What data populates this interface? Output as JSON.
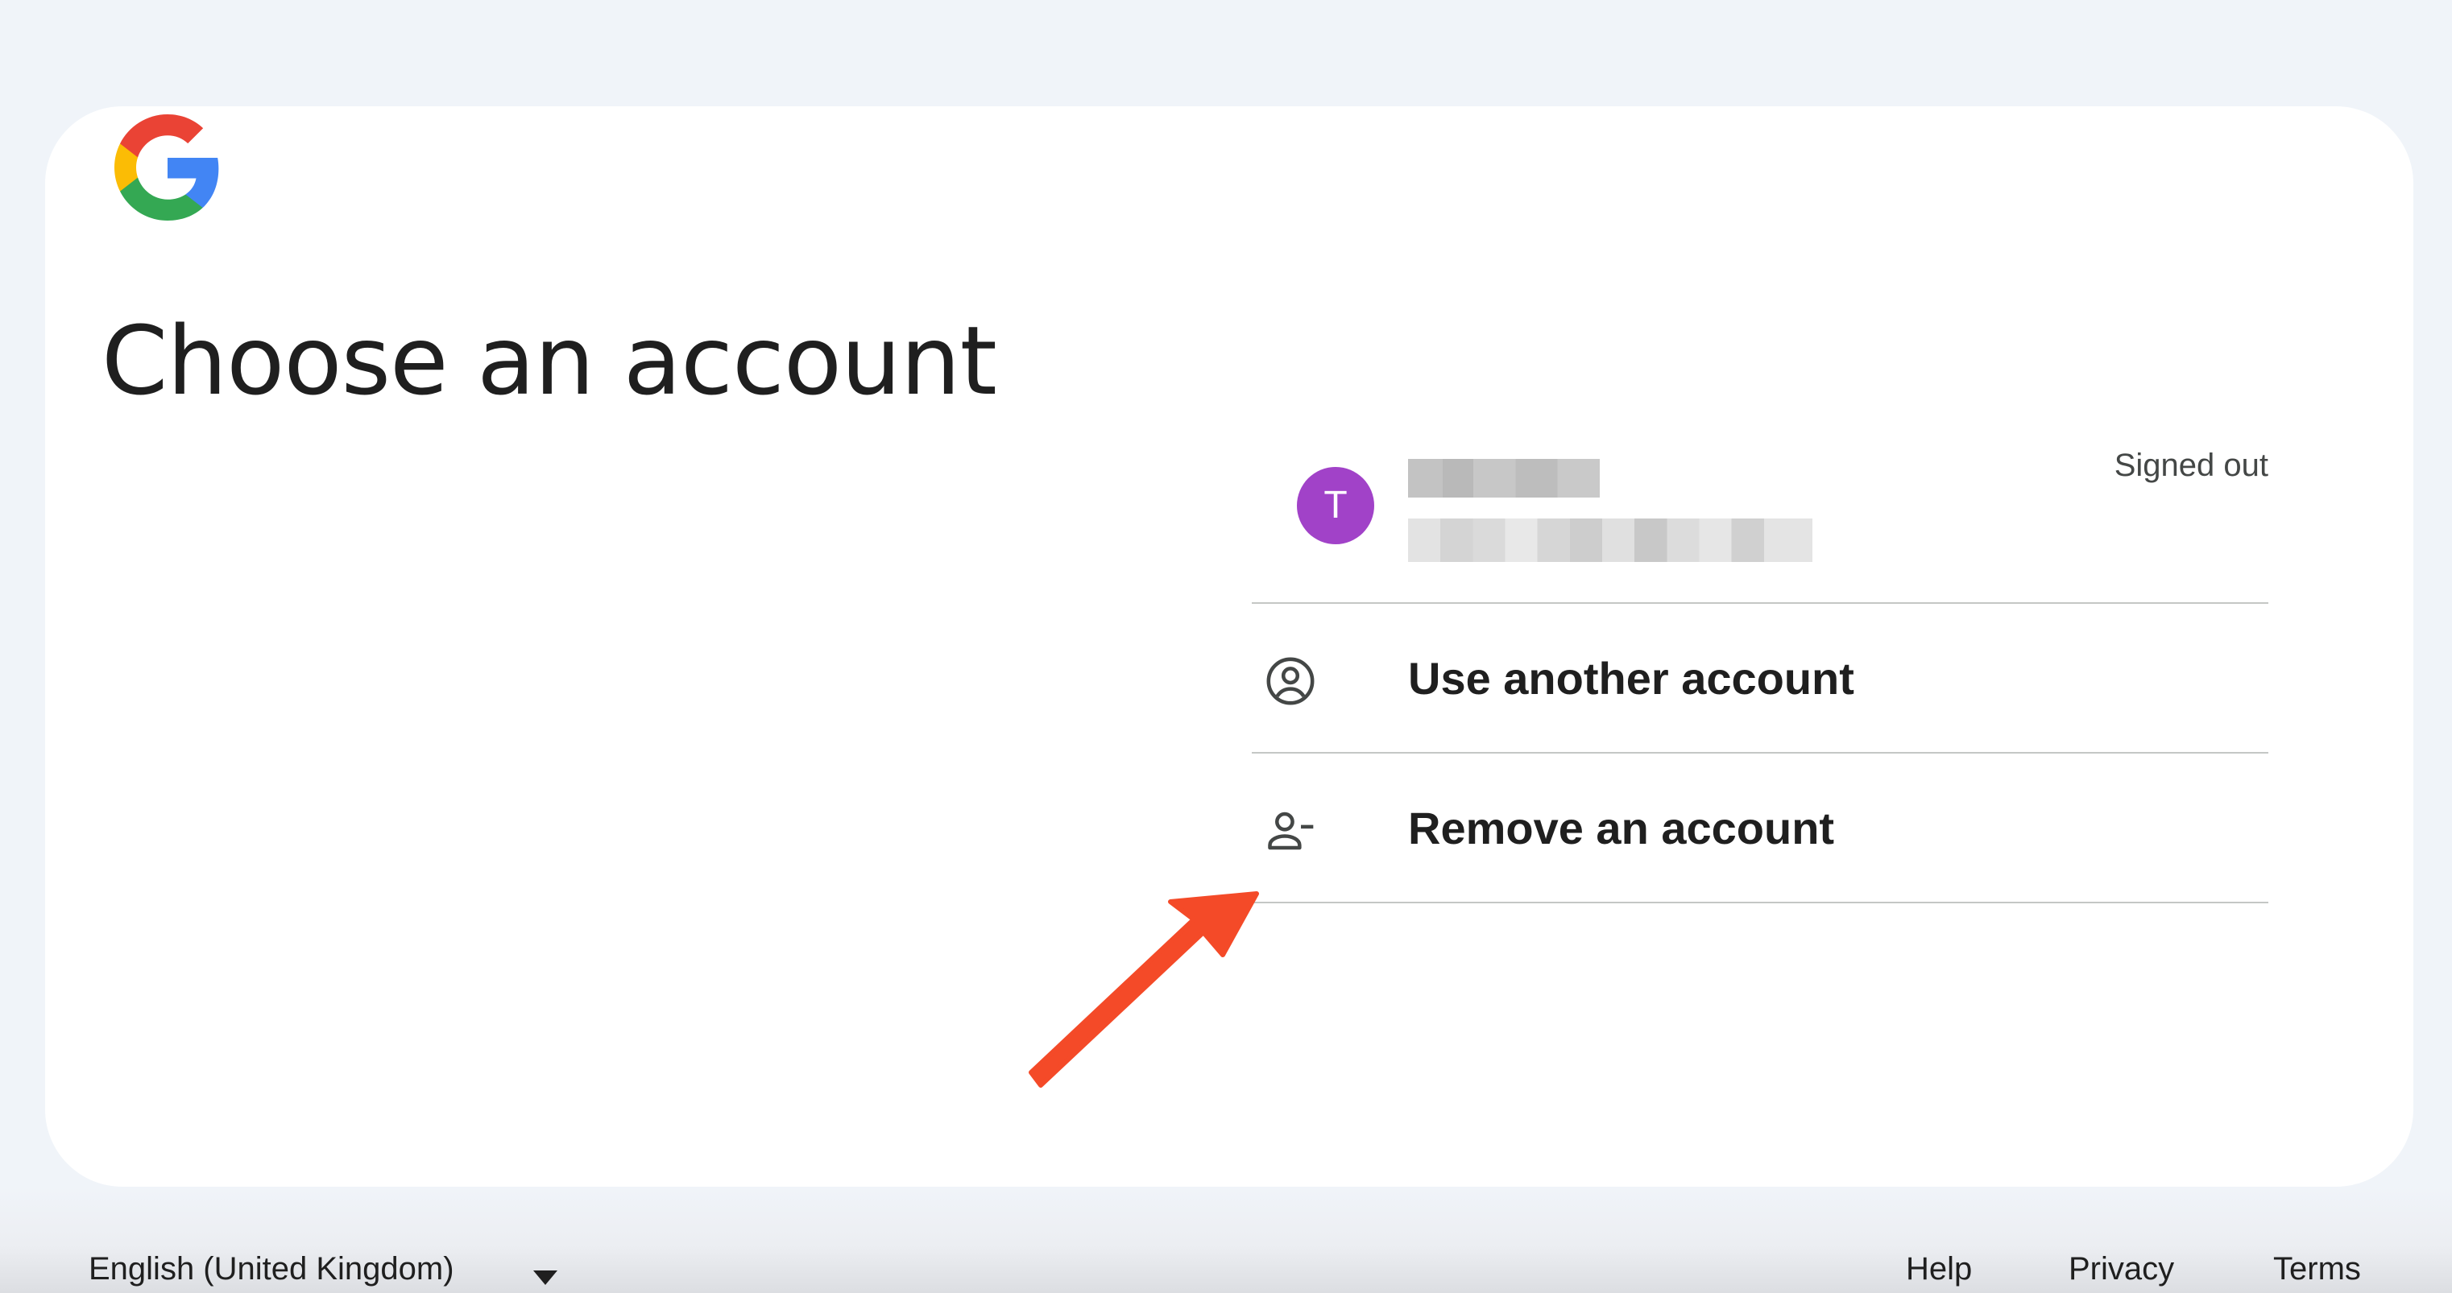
{
  "page": {
    "title": "Choose an account"
  },
  "logo": {
    "icon": "google-g-logo",
    "colors": {
      "red": "#ea4335",
      "yellow": "#fbbc05",
      "green": "#34a853",
      "blue": "#4285f4"
    }
  },
  "accounts": [
    {
      "avatar_initial": "T",
      "avatar_color": "#a142c8",
      "name": "",
      "email": "",
      "status": "Signed out"
    }
  ],
  "options": [
    {
      "label": "Use another account",
      "icon": "account-circle-icon"
    },
    {
      "label": "Remove an account",
      "icon": "person-remove-icon"
    }
  ],
  "annotation": {
    "icon": "pointer-arrow",
    "color": "#f44a28"
  },
  "footer": {
    "language": "English (United Kingdom)",
    "links": [
      "Help",
      "Privacy",
      "Terms"
    ]
  }
}
